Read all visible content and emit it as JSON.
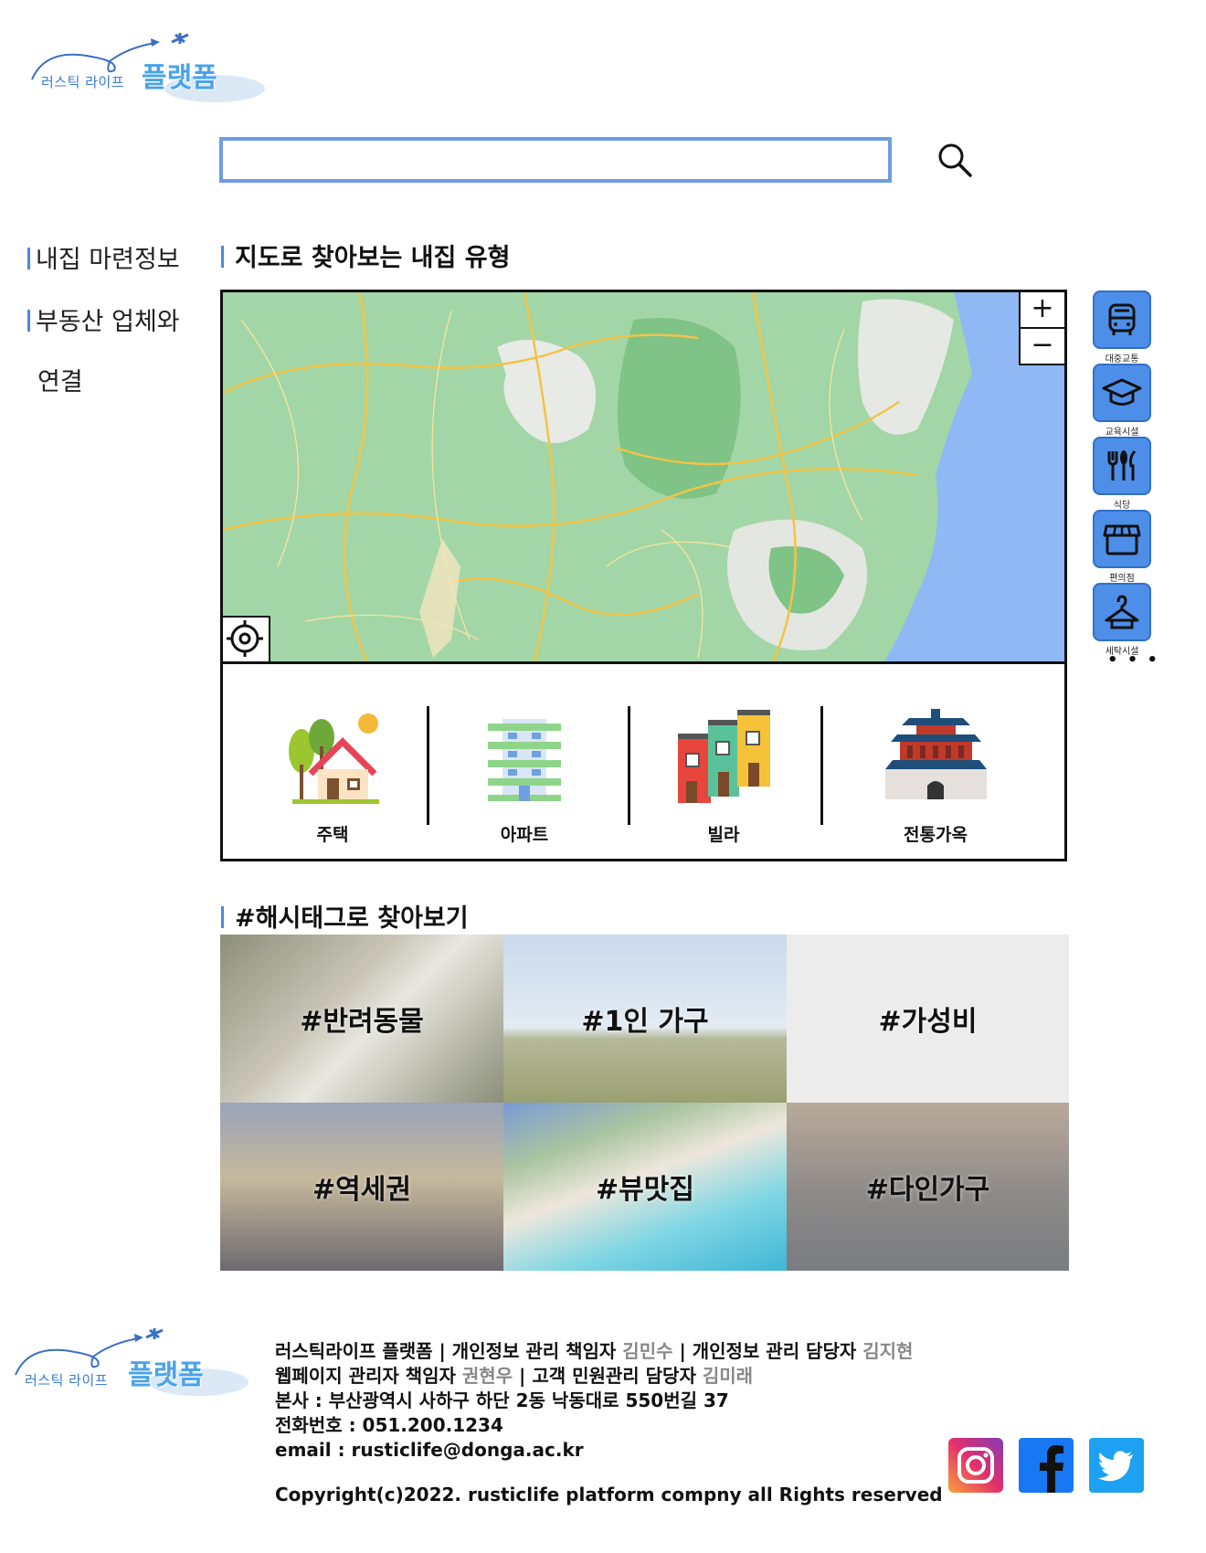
{
  "logo": {
    "small": "러스틱 라이프",
    "big": "플랫폼"
  },
  "search": {
    "value": "",
    "placeholder": ""
  },
  "sidebar": {
    "items": [
      {
        "label": "내집 마련정보"
      },
      {
        "label": "부동산 업체와",
        "label2": "연결"
      }
    ]
  },
  "map_section": {
    "title": "지도로 찾아보는 내집 유형"
  },
  "map": {
    "zoom_in": "+",
    "zoom_out": "−"
  },
  "facilities": [
    {
      "label": "대중교통",
      "icon": "bus-icon"
    },
    {
      "label": "교육시설",
      "icon": "graduation-cap-icon"
    },
    {
      "label": "식당",
      "icon": "utensils-icon"
    },
    {
      "label": "편의점",
      "icon": "store-icon"
    },
    {
      "label": "세탁시설",
      "icon": "hanger-icon"
    }
  ],
  "more_label": "• • •",
  "house_types": [
    {
      "label": "주택"
    },
    {
      "label": "아파트"
    },
    {
      "label": "빌라"
    },
    {
      "label": "전통가옥"
    }
  ],
  "hashtag_section": {
    "title": "#해시태그로 찾아보기"
  },
  "hashtags": [
    {
      "label": "#반려동물"
    },
    {
      "label": "#1인 가구"
    },
    {
      "label": "#가성비"
    },
    {
      "label": "#역세권"
    },
    {
      "label": "#뷰맛집"
    },
    {
      "label": "#다인가구"
    }
  ],
  "footer": {
    "line1_a": "러스틱라이프 플랫폼 | 개인정보 관리 책임자 ",
    "line1_b": "김민수",
    "line1_c": " | 개인정보 관리 담당자 ",
    "line1_d": "김지현",
    "line2_a": "웹페이지 관리자 책임자 ",
    "line2_b": "권현우",
    "line2_c": " | 고객 민원관리 담당자 ",
    "line2_d": "김미래",
    "line3": "본사 : 부산광역시 사하구 하단 2동 낙동대로 550번길 37",
    "line4": "전화번호 : 051.200.1234",
    "line5": "email : rusticlife@donga.ac.kr",
    "copyright": "Copyright(c)2022. rusticlife platform compny all Rights reserved"
  },
  "colors": {
    "accent": "#4d86e6",
    "map_green": "#9fd3a4",
    "sea": "#8fb8f5",
    "facility_btn": "#4d8fe8"
  }
}
